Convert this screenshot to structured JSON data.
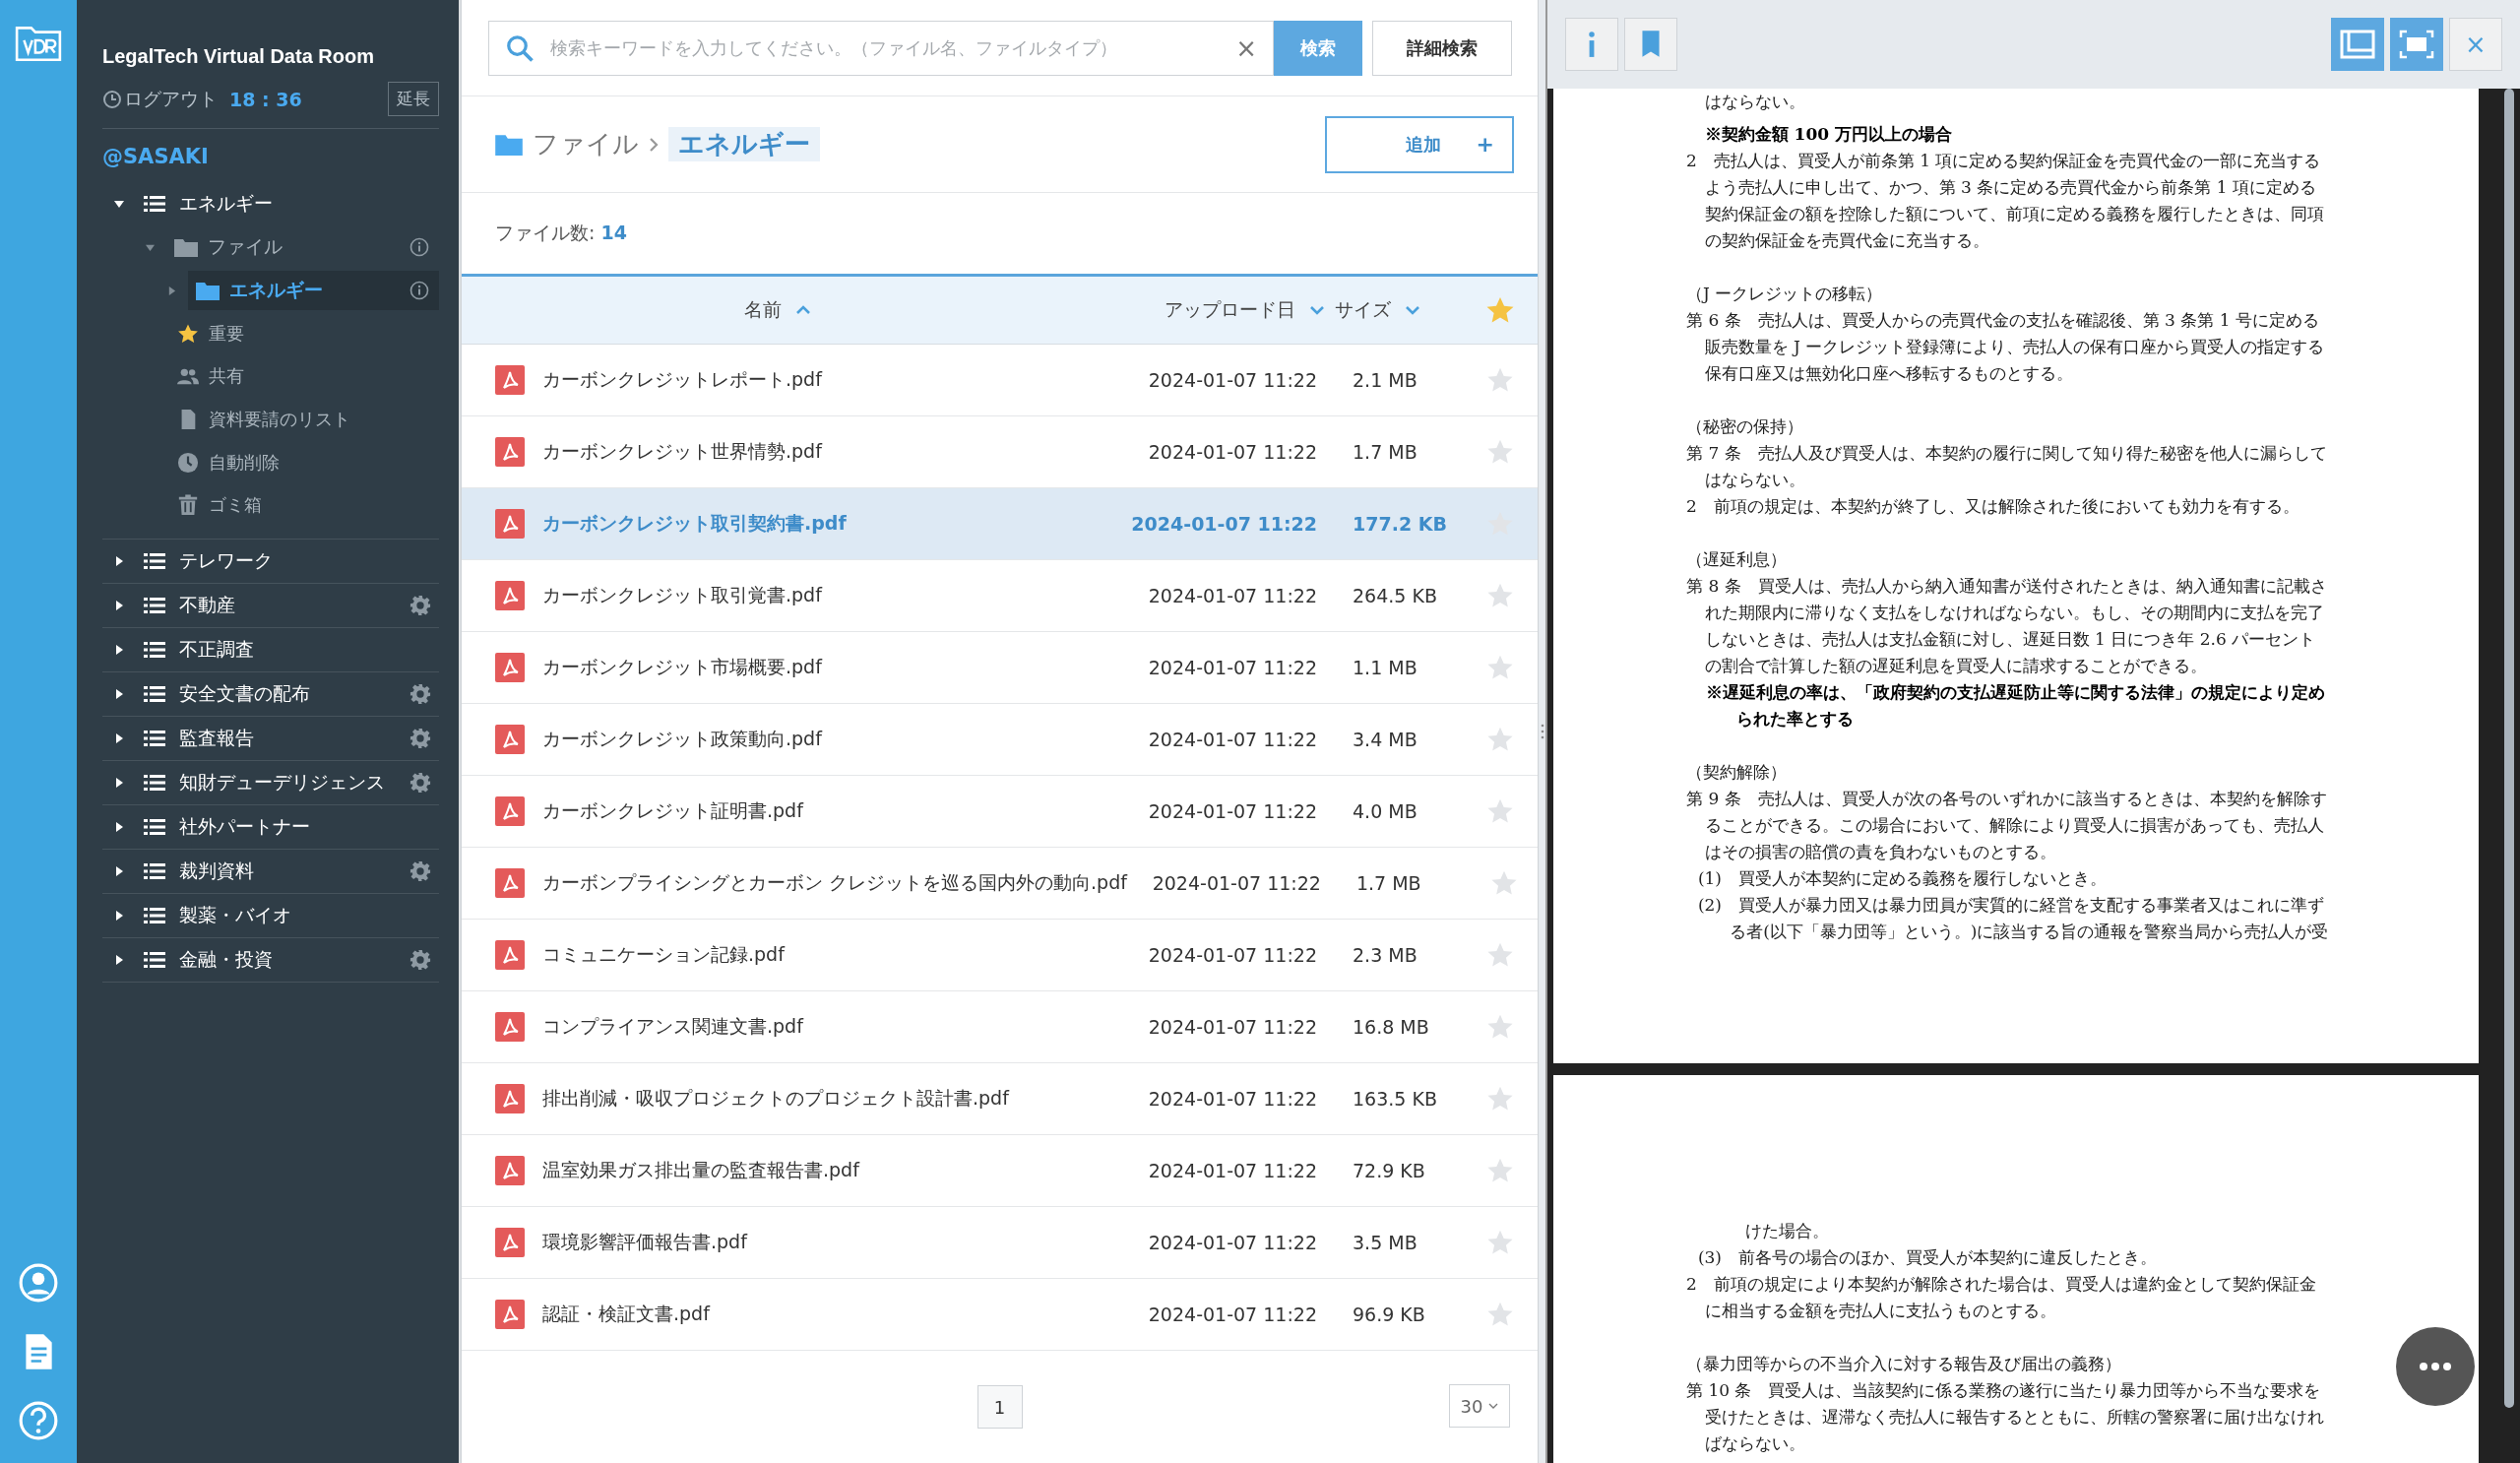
{
  "sidebar": {
    "title": "LegalTech Virtual Data Room",
    "logout": {
      "label": "ログアウト",
      "time": "18 : 36"
    },
    "extend_button": "延長",
    "user": "@SASAKI",
    "rooms": [
      {
        "label": "エネルギー",
        "expanded": true,
        "settings": false,
        "folders": [
          {
            "label": "ファイル",
            "expanded": true,
            "selected": false,
            "children": [
              {
                "label": "エネルギー",
                "expanded": false,
                "selected": true
              }
            ]
          }
        ],
        "shortcuts": [
          {
            "kind": "important",
            "label": "重要"
          },
          {
            "kind": "shared",
            "label": "共有"
          },
          {
            "kind": "requests",
            "label": "資料要請のリスト"
          },
          {
            "kind": "autodelete",
            "label": "自動削除"
          },
          {
            "kind": "trash",
            "label": "ゴミ箱"
          }
        ]
      },
      {
        "label": "テレワーク",
        "expanded": false,
        "settings": false
      },
      {
        "label": "不動産",
        "expanded": false,
        "settings": true
      },
      {
        "label": "不正調査",
        "expanded": false,
        "settings": false
      },
      {
        "label": "安全文書の配布",
        "expanded": false,
        "settings": true
      },
      {
        "label": "監査報告",
        "expanded": false,
        "settings": true
      },
      {
        "label": "知財デューデリジェンス",
        "expanded": false,
        "settings": true
      },
      {
        "label": "社外パートナー",
        "expanded": false,
        "settings": false
      },
      {
        "label": "裁判資料",
        "expanded": false,
        "settings": true
      },
      {
        "label": "製薬・バイオ",
        "expanded": false,
        "settings": false
      },
      {
        "label": "金融・投資",
        "expanded": false,
        "settings": true
      }
    ]
  },
  "search": {
    "placeholder": "検索キーワードを入力してください。（ファイル名、ファイルタイプ）",
    "clear": "×",
    "button": "検索",
    "advanced_button": "詳細検索"
  },
  "breadcrumb": [
    "ファイル",
    "エネルギー"
  ],
  "add_button": {
    "label": "追加",
    "icon": "+"
  },
  "file_count": {
    "label": "ファイル数:",
    "value": "14"
  },
  "table": {
    "columns": [
      {
        "label": "名前",
        "ascending": true
      },
      {
        "label": "アップロード日",
        "ascending": false
      },
      {
        "label": "サイズ",
        "ascending": false
      }
    ],
    "rows": [
      {
        "name": "カーボンクレジットレポート.pdf",
        "date": "2024-01-07 11:22",
        "size": "2.1 MB",
        "selected": false,
        "starred": false
      },
      {
        "name": "カーボンクレジット世界情勢.pdf",
        "date": "2024-01-07 11:22",
        "size": "1.7 MB",
        "selected": false,
        "starred": false
      },
      {
        "name": "カーボンクレジット取引契約書.pdf",
        "date": "2024-01-07 11:22",
        "size": "177.2 KB",
        "selected": true,
        "starred": false
      },
      {
        "name": "カーボンクレジット取引覚書.pdf",
        "date": "2024-01-07 11:22",
        "size": "264.5 KB",
        "selected": false,
        "starred": false
      },
      {
        "name": "カーボンクレジット市場概要.pdf",
        "date": "2024-01-07 11:22",
        "size": "1.1 MB",
        "selected": false,
        "starred": false
      },
      {
        "name": "カーボンクレジット政策動向.pdf",
        "date": "2024-01-07 11:22",
        "size": "3.4 MB",
        "selected": false,
        "starred": false
      },
      {
        "name": "カーボンクレジット証明書.pdf",
        "date": "2024-01-07 11:22",
        "size": "4.0 MB",
        "selected": false,
        "starred": false
      },
      {
        "name": "カーボンプライシングとカーボン クレジットを巡る国内外の動向.pdf",
        "date": "2024-01-07 11:22",
        "size": "1.7 MB",
        "selected": false,
        "starred": false
      },
      {
        "name": "コミュニケーション記録.pdf",
        "date": "2024-01-07 11:22",
        "size": "2.3 MB",
        "selected": false,
        "starred": false
      },
      {
        "name": "コンプライアンス関連文書.pdf",
        "date": "2024-01-07 11:22",
        "size": "16.8 MB",
        "selected": false,
        "starred": false
      },
      {
        "name": "排出削減・吸収プロジェクトのプロジェクト設計書.pdf",
        "date": "2024-01-07 11:22",
        "size": "163.5 KB",
        "selected": false,
        "starred": false
      },
      {
        "name": "温室効果ガス排出量の監査報告書.pdf",
        "date": "2024-01-07 11:22",
        "size": "72.9 KB",
        "selected": false,
        "starred": false
      },
      {
        "name": "環境影響評価報告書.pdf",
        "date": "2024-01-07 11:22",
        "size": "3.5 MB",
        "selected": false,
        "starred": false
      },
      {
        "name": "認証・検証文書.pdf",
        "date": "2024-01-07 11:22",
        "size": "96.9 KB",
        "selected": false,
        "starred": false
      }
    ]
  },
  "pagination": {
    "pages": [
      {
        "label": "1",
        "selected": true
      }
    ],
    "per_page": "30"
  },
  "viewer": {
    "close": "×",
    "pages": [
      {
        "blocks": [
          {
            "kind": "cont",
            "text": "はならない。"
          },
          {
            "kind": "note",
            "text": "※契約金額 100 万円以上の場合"
          },
          {
            "kind": "para",
            "text": "2　売払人は、買受人が前条第 1 項に定める契約保証金を売買代金の一部に充当するよう売払人に申し出て、かつ、第 3 条に定める売買代金から前条第 1 項に定める契約保証金の額を控除した額について、前項に定める義務を履行したときは、同項の契約保証金を売買代金に充当する。"
          },
          {
            "kind": "heading",
            "text": "（J ークレジットの移転）"
          },
          {
            "kind": "para",
            "text": "第 6 条　売払人は、買受人からの売買代金の支払を確認後、第 3 条第 1 号に定める販売数量を J ークレジット登録簿により、売払人の保有口座から買受人の指定する保有口座又は無効化口座へ移転するものとする。"
          },
          {
            "kind": "heading",
            "text": "（秘密の保持）"
          },
          {
            "kind": "para",
            "text": "第 7 条　売払人及び買受人は、本契約の履行に関して知り得た秘密を他人に漏らしてはならない。"
          },
          {
            "kind": "para",
            "text": "2　前項の規定は、本契約が終了し、又は解除された後においても効力を有する。"
          },
          {
            "kind": "heading",
            "text": "（遅延利息）"
          },
          {
            "kind": "para",
            "text": "第 8 条　買受人は、売払人から納入通知書が送付されたときは、納入通知書に記載された期限内に滞りなく支払をしなければならない。もし、その期間内に支払を完了しないときは、売払人は支払金額に対し、遅延日数 1 日につき年 2.6 パーセントの割合で計算した額の遅延利息を買受人に請求することができる。"
          },
          {
            "kind": "note",
            "text": "※遅延利息の率は、「政府契約の支払遅延防止等に関する法律」の規定により定められた率とする"
          },
          {
            "kind": "heading",
            "text": "（契約解除）"
          },
          {
            "kind": "para",
            "text": "第 9 条　売払人は、買受人が次の各号のいずれかに該当するときは、本契約を解除することができる。この場合において、解除により買受人に損害があっても、売払人はその損害の賠償の責を負わないものとする。"
          },
          {
            "kind": "item",
            "text": "(1)　買受人が本契約に定める義務を履行しないとき。"
          },
          {
            "kind": "item",
            "text": "(2)　買受人が暴力団又は暴力団員が実質的に経営を支配する事業者又はこれに準ずる者(以下「暴力団等」という。)に該当する旨の通報を警察当局から売払人が受"
          }
        ]
      },
      {
        "blocks": [
          {
            "kind": "cont2",
            "text": "けた場合。"
          },
          {
            "kind": "item",
            "text": "(3)　前各号の場合のほか、買受人が本契約に違反したとき。"
          },
          {
            "kind": "para",
            "text": "2　前項の規定により本契約が解除された場合は、買受人は違約金として契約保証金に相当する金額を売払人に支払うものとする。"
          },
          {
            "kind": "heading",
            "text": "（暴力団等からの不当介入に対する報告及び届出の義務）"
          },
          {
            "kind": "para",
            "text": "第 10 条　買受人は、当該契約に係る業務の遂行に当たり暴力団等から不当な要求を受けたときは、遅滞なく売払人に報告するとともに、所轄の警察署に届け出なければならない。"
          }
        ]
      }
    ]
  }
}
